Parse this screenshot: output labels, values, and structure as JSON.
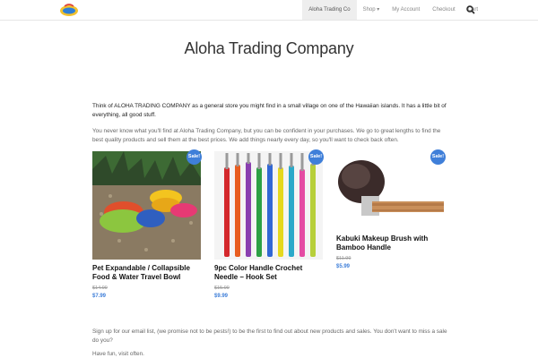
{
  "header": {
    "logo_icon": "aloha-logo",
    "nav": [
      {
        "label": "Aloha Trading Co"
      },
      {
        "label": "Shop ▾"
      },
      {
        "label": "My Account"
      },
      {
        "label": "Checkout"
      },
      {
        "label": "Cart"
      }
    ],
    "search_icon": "search-icon"
  },
  "main": {
    "title": "Aloha Trading Company",
    "intro": "Think of ALOHA TRADING COMPANY as a general store you might find in a small village on one of the Hawaiian islands. It has a little bit of everything, all good stuff.",
    "intro2": "You never know what you'll find at Aloha Trading Company, but you can be confident in your purchases. We go to great lengths to find the best quality products and sell them at the best prices. We add things nearly every day, so you'll want to check back often.",
    "products": [
      {
        "name": "Pet Expandable / Collapsible Food & Water Travel Bowl",
        "old_price": "$14.99",
        "price": "$7.99",
        "badge": "Sale!"
      },
      {
        "name": "9pc Color Handle Crochet Needle – Hook Set",
        "old_price": "$15.99",
        "price": "$9.99",
        "badge": "Sale!"
      },
      {
        "name": "Kabuki Makeup Brush with Bamboo Handle",
        "old_price": "$11.99",
        "price": "$5.99",
        "badge": "Sale!"
      }
    ],
    "signup": "Sign up for our email list, (we promise not to be pests!) to be the first to find out about new products and sales. You don't want to miss a sale do you?",
    "closing": "Have fun, visit often."
  },
  "colors": {
    "accent": "#3f7fd9",
    "nav_active_bg": "#eeeeee"
  }
}
